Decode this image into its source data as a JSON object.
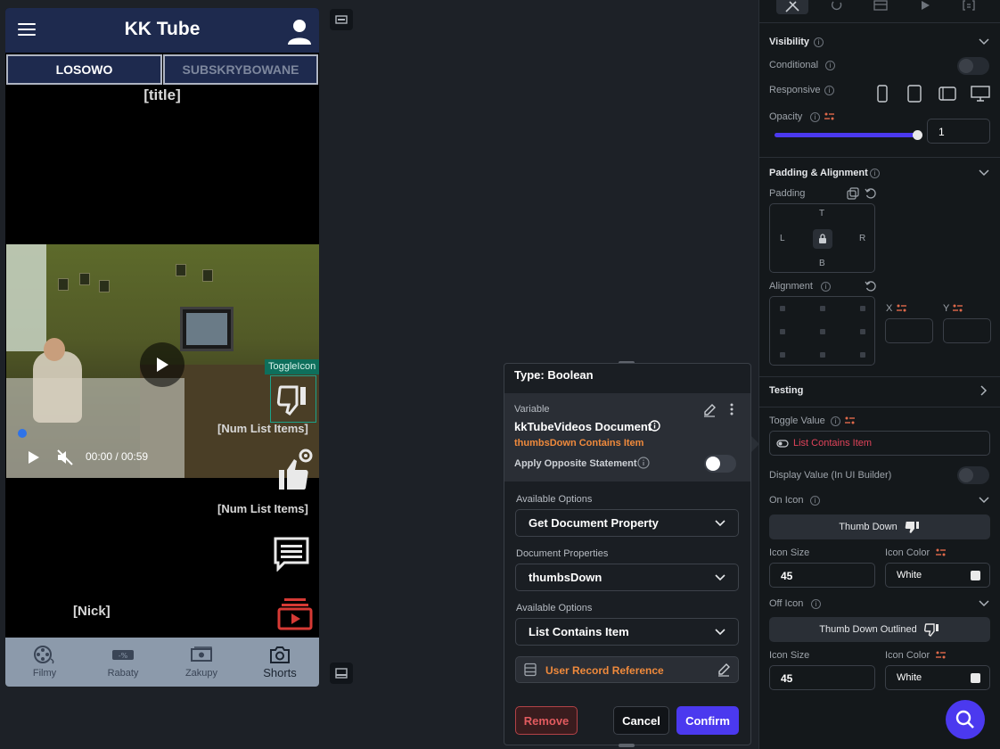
{
  "phone": {
    "app_title": "KK Tube",
    "tabs": [
      {
        "label": "LOSOWO"
      },
      {
        "label": "SUBSKRYBOWANE"
      }
    ],
    "title_placeholder": "[title]",
    "video_time": "00:00 / 00:59",
    "toggle_tag": "ToggleIcon",
    "num_list_1": "[Num List Items]",
    "num_list_2": "[Num List Items]",
    "nick": "[Nick]",
    "bottom_nav": [
      {
        "label": "Filmy",
        "icon": "film-reel-icon"
      },
      {
        "label": "Rabaty",
        "icon": "discount-ticket-icon"
      },
      {
        "label": "Zakupy",
        "icon": "money-icon"
      },
      {
        "label": "Shorts",
        "icon": "camera-icon"
      }
    ]
  },
  "popup": {
    "type_label": "Type: Boolean",
    "variable_caption": "Variable",
    "variable_name": "kkTubeVideos Document",
    "variable_sub": "thumbsDown Contains Item",
    "apply_opposite": "Apply Opposite Statement",
    "apply_opposite_on": false,
    "available_options_label_1": "Available Options",
    "available_options_value_1": "Get Document Property",
    "document_properties_label": "Document Properties",
    "document_properties_value": "thumbsDown",
    "available_options_label_2": "Available Options",
    "available_options_value_2": "List Contains Item",
    "user_ref": "User Record Reference",
    "remove": "Remove",
    "cancel": "Cancel",
    "confirm": "Confirm"
  },
  "panel": {
    "visibility": {
      "header": "Visibility",
      "conditional": "Conditional",
      "responsive": "Responsive",
      "opacity": "Opacity",
      "opacity_value": "1",
      "opacity_level": 1.0
    },
    "padding_alignment": {
      "header": "Padding & Alignment",
      "padding": "Padding",
      "pad_t": "T",
      "pad_l": "L",
      "pad_r": "R",
      "pad_b": "B",
      "alignment": "Alignment",
      "x_label": "X",
      "y_label": "Y"
    },
    "testing": {
      "header": "Testing"
    },
    "toggle": {
      "toggle_value_label": "Toggle Value",
      "toggle_value": "List Contains Item",
      "display_value_label": "Display Value (In UI Builder)",
      "on_icon_label": "On Icon",
      "on_icon_name": "Thumb Down",
      "icon_size_label": "Icon Size",
      "icon_color_label": "Icon Color",
      "on_icon_size": "45",
      "on_icon_color": "White",
      "off_icon_label": "Off Icon",
      "off_icon_name": "Thumb Down Outlined",
      "off_icon_size": "45",
      "off_icon_color": "White"
    }
  },
  "colors": {
    "accent": "#4b39ef",
    "warning_text": "#f08a3c",
    "danger": "#e25b5f",
    "appbar": "#1e2a4e",
    "panel_bg": "#14181b"
  }
}
